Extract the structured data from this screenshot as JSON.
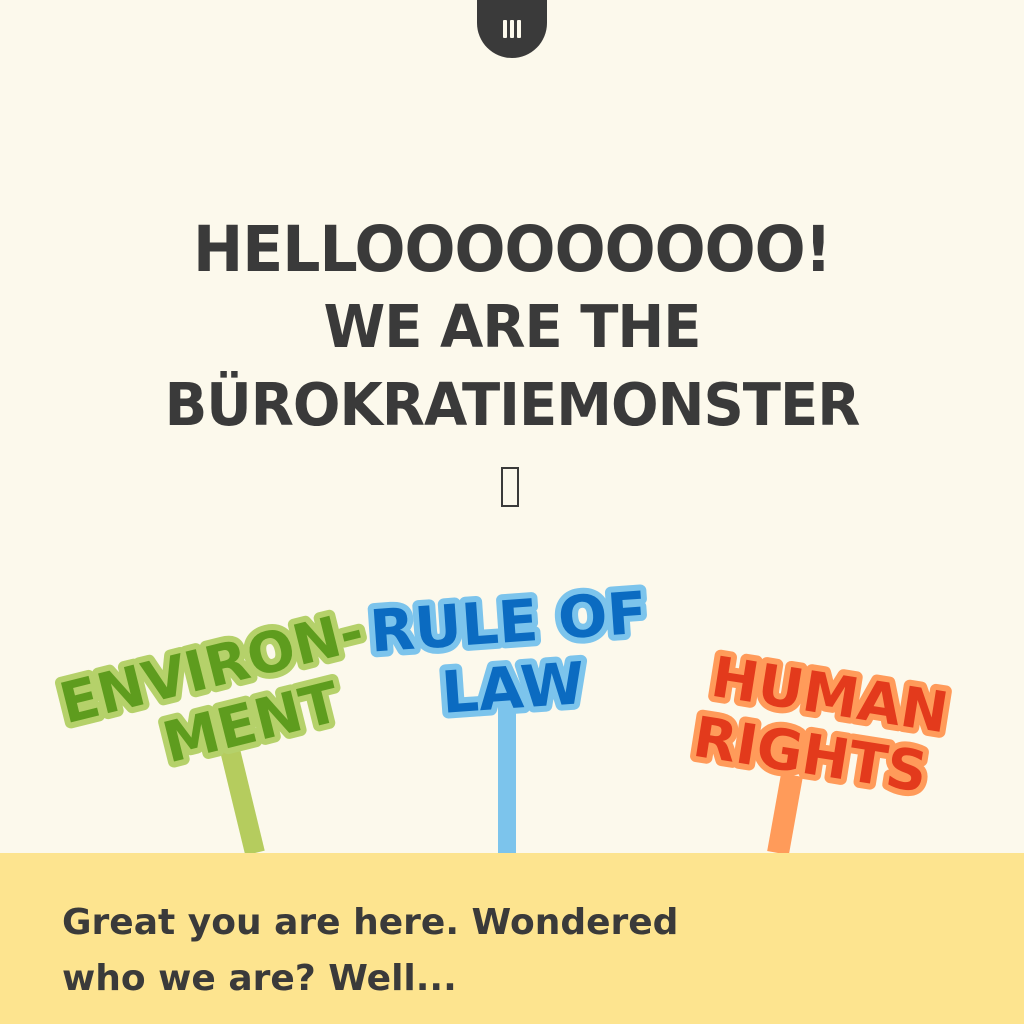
{
  "menu": {
    "icon": "menu-icon"
  },
  "hero": {
    "line1": "HELLOOOOOOOOO!",
    "line2": "WE ARE THE",
    "line3": "BÜROKRATIEMONSTER"
  },
  "scroll_icon": "missing-glyph-icon",
  "signs": {
    "environment": {
      "line1": "ENVIRON-",
      "line2": "MENT",
      "fill": "#5e9c1e",
      "outline": "#b5d16a",
      "stick": "#b5cc5e"
    },
    "rule_of_law": {
      "line1": "RULE OF",
      "line2": "LAW",
      "fill": "#0b6bc1",
      "outline": "#7cc4ec",
      "stick": "#7cc4ec"
    },
    "human_rights": {
      "line1": "HUMAN",
      "line2": "RIGHTS",
      "fill": "#e33a1c",
      "outline": "#ff9b5a",
      "stick": "#ff9b5a"
    }
  },
  "footer": {
    "text_line1": "Great you are here. Wondered",
    "text_line2": "who we are? Well..."
  },
  "colors": {
    "background": "#fcf9ec",
    "footer": "#fde48f",
    "ink": "#3a3a3a"
  }
}
